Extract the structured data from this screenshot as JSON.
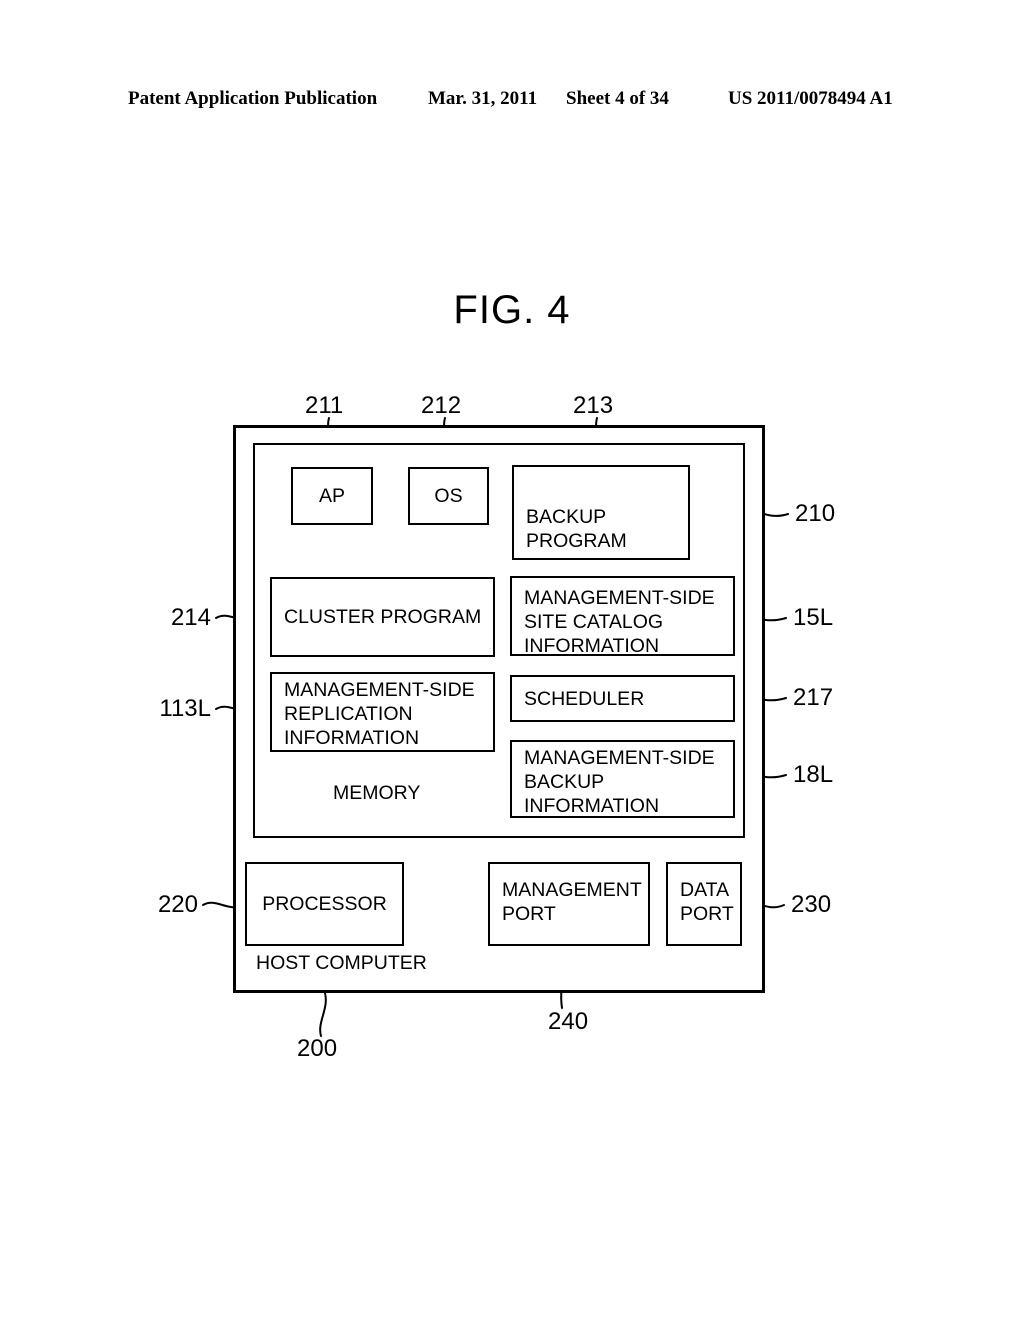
{
  "header": {
    "publication": "Patent Application Publication",
    "date": "Mar. 31, 2011",
    "sheet": "Sheet 4 of 34",
    "patent_number": "US 2011/0078494 A1"
  },
  "figure": {
    "title": "FIG. 4",
    "outer_box_label": "HOST COMPUTER",
    "memory_box_label": "MEMORY"
  },
  "blocks": {
    "ap": "AP",
    "os": "OS",
    "backup_program": "BACKUP\nPROGRAM",
    "cluster_program": "CLUSTER PROGRAM",
    "site_catalog": "MANAGEMENT-SIDE\nSITE CATALOG\nINFORMATION",
    "replication_info": "MANAGEMENT-SIDE\nREPLICATION\nINFORMATION",
    "scheduler": "SCHEDULER",
    "backup_info": "MANAGEMENT-SIDE\nBACKUP\nINFORMATION",
    "processor": "PROCESSOR",
    "management_port": "MANAGEMENT\nPORT",
    "data_port": "DATA\nPORT"
  },
  "refs": {
    "ap": "211",
    "os": "212",
    "backup_program": "213",
    "memory": "210",
    "cluster_program": "214",
    "site_catalog": "15L",
    "replication_info": "113L",
    "scheduler": "217",
    "backup_info": "18L",
    "processor": "220",
    "data_port": "230",
    "management_port": "240",
    "host_computer": "200"
  },
  "colors": {
    "ink": "#000000",
    "paper": "#ffffff"
  }
}
